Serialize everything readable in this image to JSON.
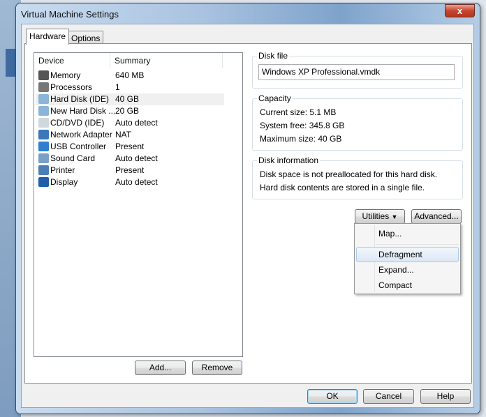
{
  "window": {
    "title": "Virtual Machine Settings",
    "close": "x"
  },
  "tabs": [
    {
      "label": "Hardware"
    },
    {
      "label": "Options"
    }
  ],
  "device_list": {
    "headers": [
      "Device",
      "Summary"
    ],
    "rows": [
      {
        "device": "Memory",
        "summary": "640 MB",
        "icon": "memory-icon",
        "color": "#555"
      },
      {
        "device": "Processors",
        "summary": "1",
        "icon": "processor-icon",
        "color": "#777"
      },
      {
        "device": "Hard Disk (IDE)",
        "summary": "40 GB",
        "icon": "hard-disk-icon",
        "color": "#8ab4d8",
        "selected": true
      },
      {
        "device": "New Hard Disk ...",
        "summary": "20 GB",
        "icon": "hard-disk-icon",
        "color": "#8ab4d8"
      },
      {
        "device": "CD/DVD (IDE)",
        "summary": "Auto detect",
        "icon": "cd-icon",
        "color": "#cfd8dc"
      },
      {
        "device": "Network Adapter",
        "summary": "NAT",
        "icon": "network-icon",
        "color": "#3b78b8"
      },
      {
        "device": "USB Controller",
        "summary": "Present",
        "icon": "usb-icon",
        "color": "#2f7fd0"
      },
      {
        "device": "Sound Card",
        "summary": "Auto detect",
        "icon": "speaker-icon",
        "color": "#7aa0c8"
      },
      {
        "device": "Printer",
        "summary": "Present",
        "icon": "printer-icon",
        "color": "#4d7fb5"
      },
      {
        "device": "Display",
        "summary": "Auto detect",
        "icon": "display-icon",
        "color": "#1f5fa8"
      }
    ],
    "add": "Add...",
    "remove": "Remove"
  },
  "disk_file": {
    "label": "Disk file",
    "value": "Windows XP Professional.vmdk"
  },
  "capacity": {
    "label": "Capacity",
    "current": "Current size:  5.1 MB",
    "free": "System free:  345.8 GB",
    "max": "Maximum size:  40 GB"
  },
  "disk_info": {
    "label": "Disk information",
    "line1": "Disk space is not preallocated for this hard disk.",
    "line2": "Hard disk contents are stored in a single file."
  },
  "utilities": "Utilities",
  "advanced": "Advanced...",
  "menu": [
    "Map...",
    "Defragment",
    "Expand...",
    "Compact"
  ],
  "footer": {
    "ok": "OK",
    "cancel": "Cancel",
    "help": "Help"
  }
}
